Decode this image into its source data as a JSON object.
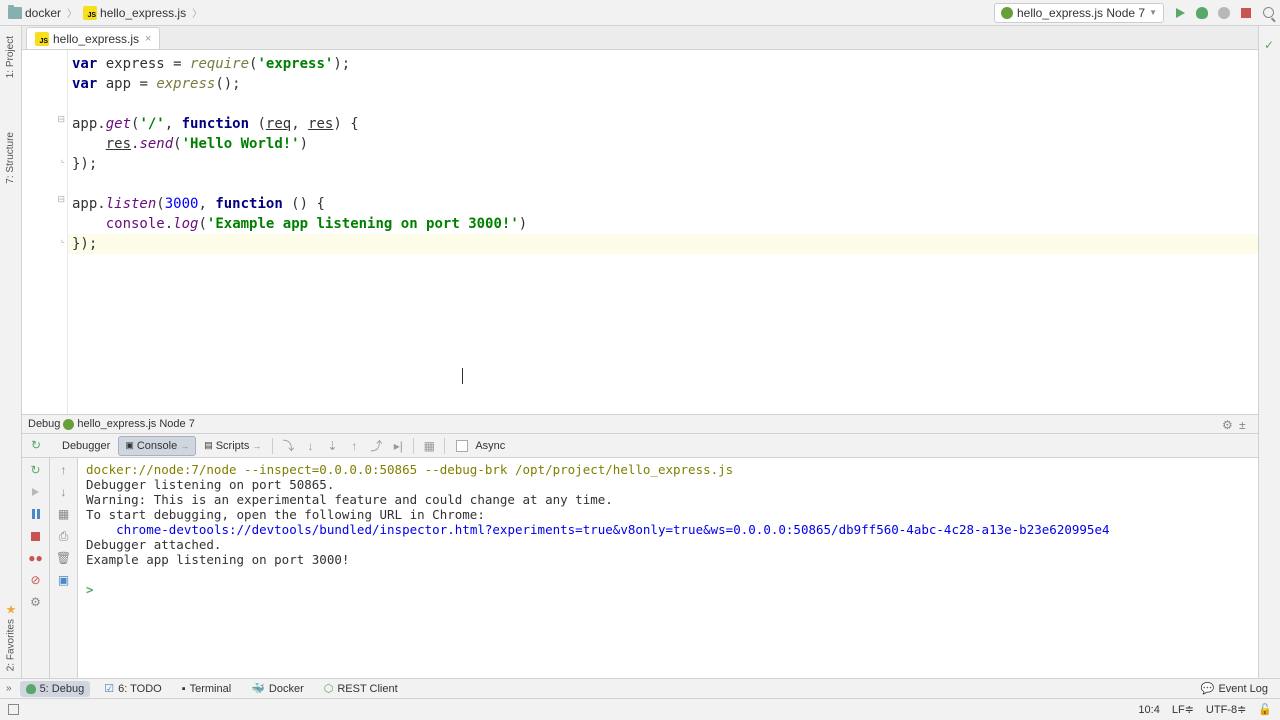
{
  "breadcrumb": {
    "folder": "docker",
    "file": "hello_express.js"
  },
  "run_config": {
    "label": "hello_express.js Node 7"
  },
  "tabs": {
    "file": "hello_express.js"
  },
  "code": {
    "l1_p1": "var",
    "l1_p2": " express = ",
    "l1_p3": "require",
    "l1_p4": "(",
    "l1_p5": "'express'",
    "l1_p6": ");",
    "l2_p1": "var",
    "l2_p2": " app = ",
    "l2_p3": "express",
    "l2_p4": "();",
    "l4_p1": "app.",
    "l4_p2": "get",
    "l4_p3": "(",
    "l4_p4": "'/'",
    "l4_p5": ", ",
    "l4_p6": "function",
    "l4_p7": " (",
    "l4_p8": "req",
    "l4_p9": ", ",
    "l4_p10": "res",
    "l4_p11": ") {",
    "l5_p1": "    ",
    "l5_p2": "res",
    "l5_p3": ".",
    "l5_p4": "send",
    "l5_p5": "(",
    "l5_p6": "'Hello World!'",
    "l5_p7": ")",
    "l6": "});",
    "l8_p1": "app.",
    "l8_p2": "listen",
    "l8_p3": "(",
    "l8_p4": "3000",
    "l8_p5": ", ",
    "l8_p6": "function",
    "l8_p7": " () {",
    "l9_p1": "    ",
    "l9_p2": "console",
    "l9_p3": ".",
    "l9_p4": "log",
    "l9_p5": "(",
    "l9_p6": "'Example app listening on port 3000!'",
    "l9_p7": ")",
    "l10": "});"
  },
  "debug_header": {
    "label": "Debug",
    "config": "hello_express.js Node 7"
  },
  "debug_tabs": {
    "debugger": "Debugger",
    "console": "Console",
    "scripts": "Scripts",
    "async": "Async"
  },
  "console": {
    "cmd": "docker://node:7/node --inspect=0.0.0.0:50865 --debug-brk /opt/project/hello_express.js",
    "l2": "Debugger listening on port 50865.",
    "l3": "Warning: This is an experimental feature and could change at any time.",
    "l4": "To start debugging, open the following URL in Chrome:",
    "l5": "    chrome-devtools://devtools/bundled/inspector.html?experiments=true&v8only=true&ws=0.0.0.0:50865/db9ff560-4abc-4c28-a13e-b23e620995e4",
    "l6": "Debugger attached.",
    "l7": "Example app listening on port 3000!",
    "prompt": ">"
  },
  "bottom": {
    "debug": "5: Debug",
    "todo": "6: TODO",
    "terminal": "Terminal",
    "docker": "Docker",
    "rest": "REST Client",
    "eventlog": "Event Log"
  },
  "side": {
    "project": "1: Project",
    "structure": "7: Structure",
    "favorites": "2: Favorites"
  },
  "status": {
    "pos": "10:4",
    "lf": "LF≑",
    "enc": "UTF-8≑"
  }
}
